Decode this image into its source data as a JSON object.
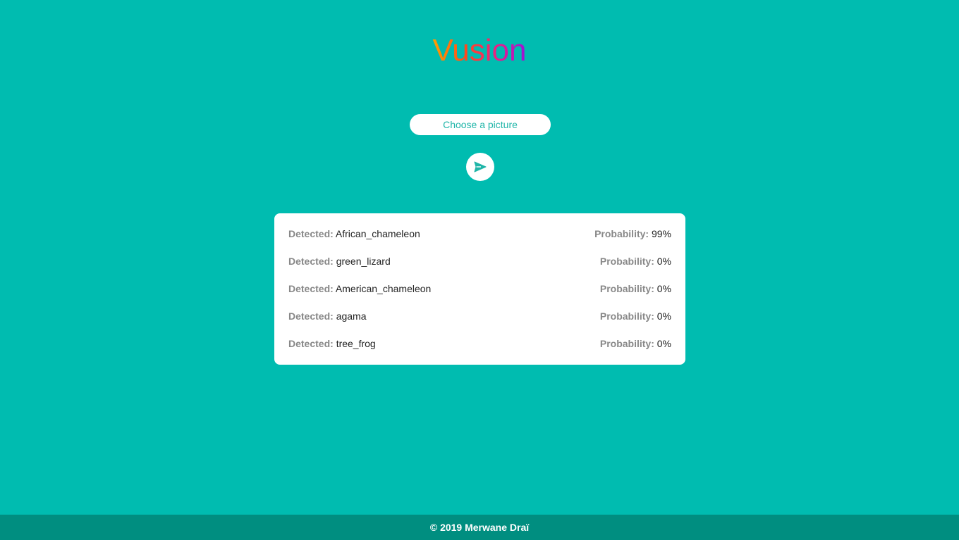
{
  "header": {
    "logo_text": "Vusion",
    "logo_gradient": [
      "#ff9a00",
      "#ff3d2e",
      "#e8208c",
      "#a010d8"
    ]
  },
  "upload": {
    "choose_label": "Choose a picture",
    "send_icon": "send-icon"
  },
  "results": {
    "detected_label": "Detected:",
    "probability_label": "Probability:",
    "items": [
      {
        "name": "African_chameleon",
        "probability": "99%"
      },
      {
        "name": "green_lizard",
        "probability": "0%"
      },
      {
        "name": "American_chameleon",
        "probability": "0%"
      },
      {
        "name": "agama",
        "probability": "0%"
      },
      {
        "name": "tree_frog",
        "probability": "0%"
      }
    ]
  },
  "footer": {
    "copyright": "© 2019 Merwane Draï"
  },
  "colors": {
    "background": "#00bcb0",
    "footer_background": "#008e80",
    "accent": "#1fb5a8"
  }
}
